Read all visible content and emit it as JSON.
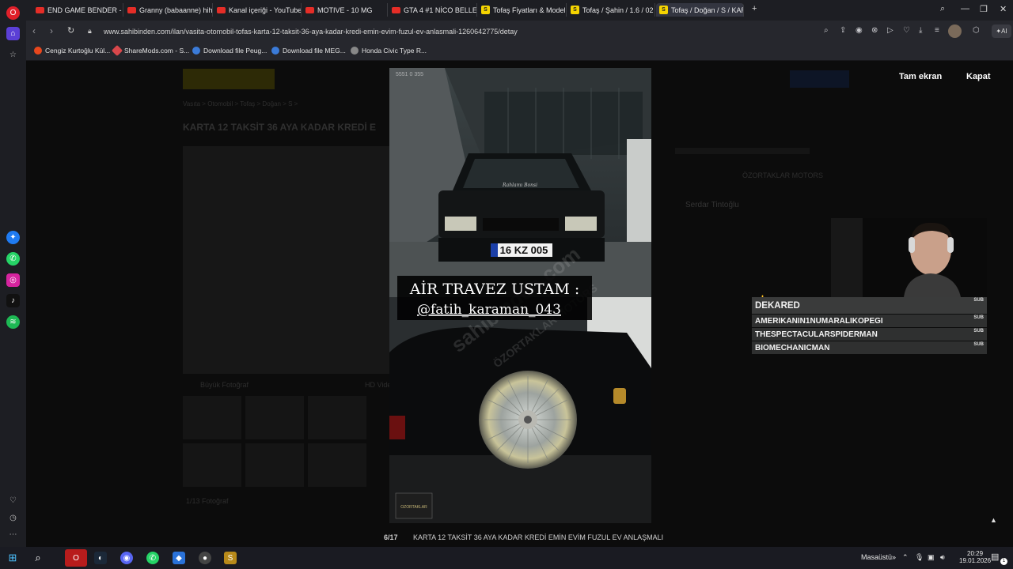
{
  "tabs": [
    {
      "label": "END GAME BENDER - You",
      "favicon": "youtube-icon"
    },
    {
      "label": "Granny (babaanne) hihi ku",
      "favicon": "youtube-icon"
    },
    {
      "label": "Kanal içeriği - YouTube St",
      "favicon": "youtube-icon"
    },
    {
      "label": "MOTIVE - 10 MG",
      "favicon": "youtube-icon"
    },
    {
      "label": "GTA 4 #1 NİCO BELLEK - Y",
      "favicon": "youtube-icon"
    },
    {
      "label": "Tofaş Fiyatları & Modeller",
      "favicon": "sahibinden-icon"
    },
    {
      "label": "Tofaş / Şahin / 1.6 / 02 RO",
      "favicon": "sahibinden-icon"
    },
    {
      "label": "Tofaş / Doğan / S / KARTA",
      "favicon": "sahibinden-icon",
      "active": true
    }
  ],
  "address": {
    "url": "www.sahibinden.com/ilan/vasita-otomobil-tofas-karta-12-taksit-36-aya-kadar-kredi-emin-evim-fuzul-ev-anlasmali-1260642775/detay"
  },
  "bookmarks": [
    {
      "label": "Cengiz Kurtoğlu Kül...",
      "color": "#e8471d"
    },
    {
      "label": "ShareMods.com - S...",
      "color": "#d8474b"
    },
    {
      "label": "Download file Peug...",
      "color": "#3b7bd8"
    },
    {
      "label": "Download file MEG...",
      "color": "#3b7bd8"
    },
    {
      "label": "Honda Civic Type R...",
      "color": "#888888"
    }
  ],
  "background_page": {
    "ad_title": "KARTA 12 TAKSİT 36 AYA KADAR KREDİ E",
    "breadcrumb": "Vasıta > Otomobil > Tofaş > Doğan > S >",
    "seller_name": "Serdar Tintoğlu",
    "store_name": "ÖZORTAKLAR MOTORS",
    "photo_count": "1/13 Fotoğraf",
    "tab_big_photo": "Büyük Fotoğraf",
    "tab_video": "HD Video"
  },
  "lightbox": {
    "full_screen_label": "Tam ekran",
    "close_label": "Kapat",
    "counter": "6/17",
    "caption": "KARTA 12 TAKSİT 36 AYA KADAR KREDİ EMİN EVİM FUZUL EV ANLAŞMALI",
    "photo": {
      "overlay_line1": "AİR TRAVEZ USTAM :",
      "overlay_line2": "@fatih_karaman_043",
      "plate": "16 KZ 005",
      "windshield_text": "Rahlamı Bonsi",
      "watermark": "sahibinden.com",
      "watermark2": "ÖZORTAKLAR MOTORS",
      "corner_label": "5551 0 355",
      "badge": "OZORTAKLAR"
    }
  },
  "stream_chat": {
    "header": "DEKARED",
    "rows": [
      "AMERIKANIN1NUMARALIKOPEGI",
      "THESPECTACULARSPIDERMAN",
      "BIOMECHANICMAN"
    ],
    "sub_label": "SUB"
  },
  "taskbar": {
    "desktop_label": "Masaüstü",
    "time": "20:29",
    "date": "19.01.2026",
    "notification_count": "1"
  },
  "colors": {
    "browser_dark": "#1d1e23",
    "sahibinden_yellow": "#f5d400",
    "youtube_red": "#e52d27"
  }
}
